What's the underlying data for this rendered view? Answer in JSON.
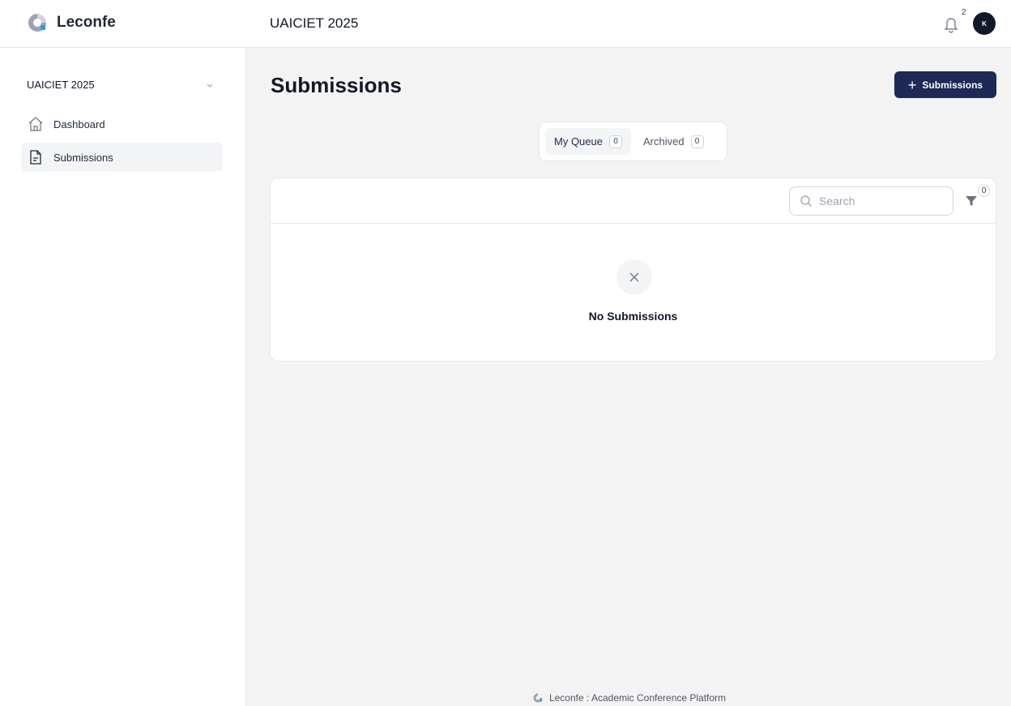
{
  "brand": {
    "name": "Leconfe",
    "logo_icon": "leconfe-logo-icon"
  },
  "header": {
    "conference_title": "UAICIET 2025",
    "notifications_count": "2",
    "avatar_initial": "K"
  },
  "sidebar": {
    "conference_selector": "UAICIET 2025",
    "items": [
      {
        "label": "Dashboard",
        "icon": "home-icon",
        "active": false
      },
      {
        "label": "Submissions",
        "icon": "document-icon",
        "active": true
      }
    ]
  },
  "main": {
    "title": "Submissions",
    "add_button_label": "Submissions",
    "tabs": [
      {
        "label": "My Queue",
        "count": "0",
        "active": true
      },
      {
        "label": "Archived",
        "count": "0",
        "active": false
      }
    ],
    "search": {
      "placeholder": "Search",
      "value": ""
    },
    "filter_count": "0",
    "empty_message": "No Submissions"
  },
  "footer": {
    "text": "Leconfe : Academic Conference Platform"
  },
  "colors": {
    "primary_button": "#1e2a55",
    "accent_logo": "#1da1f2",
    "background": "#f3f3f4"
  }
}
